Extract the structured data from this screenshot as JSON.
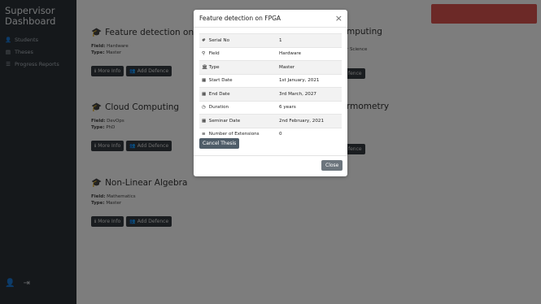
{
  "sidebar": {
    "brand": "Supervisor Dashboard",
    "items": [
      {
        "icon": "students-icon",
        "label": "Students"
      },
      {
        "icon": "theses-icon",
        "label": "Theses"
      },
      {
        "icon": "progress-reports-icon",
        "label": "Progress Reports"
      }
    ]
  },
  "cards": [
    {
      "title": "Feature detection on FPGA",
      "field_label": "Field:",
      "field": "Hardware",
      "type_label": "Type:",
      "type": "Master",
      "more_info": "More Info",
      "add_defence": "Add Defence"
    },
    {
      "title": "Cloud Computing",
      "field_label": "Field:",
      "field": "DevOps",
      "type_label": "Type:",
      "type": "PhD",
      "more_info": "More Info",
      "add_defence": "Add Defence"
    },
    {
      "title": "Non-Linear Algebra",
      "field_label": "Field:",
      "field": "Mathematics",
      "type_label": "Type:",
      "type": "Master",
      "more_info": "More Info",
      "add_defence": "Add Defence"
    }
  ],
  "right_cards": [
    {
      "title_fragment": "mputing",
      "field_fragment": "r Science",
      "button_fragment": "fence"
    },
    {
      "title_fragment": "rmometry",
      "button_fragment": "fence"
    }
  ],
  "modal": {
    "title": "Feature detection on FPGA",
    "rows": [
      {
        "icon": "#",
        "icon_name": "hash-icon",
        "label": "Serial No",
        "value": "1"
      },
      {
        "icon": "⚲",
        "icon_name": "field-pin-icon",
        "label": "Field",
        "value": "Hardware"
      },
      {
        "icon": "🏛",
        "icon_name": "institution-icon",
        "label": "Type",
        "value": "Master"
      },
      {
        "icon": "▦",
        "icon_name": "calendar-icon",
        "label": "Start Date",
        "value": "1st January, 2021"
      },
      {
        "icon": "▦",
        "icon_name": "calendar-icon",
        "label": "End Date",
        "value": "3rd March, 2027"
      },
      {
        "icon": "◷",
        "icon_name": "clock-icon",
        "label": "Duration",
        "value": "6 years"
      },
      {
        "icon": "▦",
        "icon_name": "calendar-icon",
        "label": "Seminar Date",
        "value": "2nd February, 2021"
      },
      {
        "icon": "≡",
        "icon_name": "list-icon",
        "label": "Number of Extensions",
        "value": "0"
      }
    ],
    "cancel_thesis": "Cancel Thesis",
    "close": "Close"
  }
}
